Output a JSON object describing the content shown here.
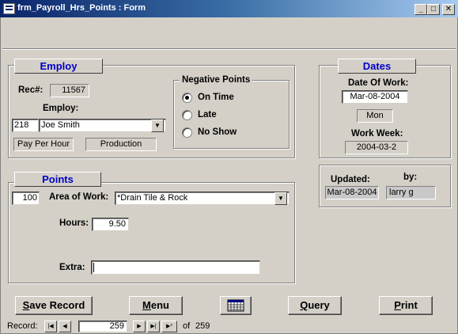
{
  "window": {
    "title": "frm_Payroll_Hrs_Points : Form",
    "min": "_",
    "max": "□",
    "close": "✕"
  },
  "employ": {
    "tab": "Employ",
    "rec_label": "Rec#:",
    "rec_value": "11567",
    "employ_label": "Employ:",
    "employee_id": "218",
    "employee_name": "Joe Smith",
    "pay_type": "Pay Per Hour",
    "department": "Production"
  },
  "negative_points": {
    "title": "Negative Points",
    "options": [
      {
        "label": "On Time",
        "selected": true
      },
      {
        "label": "Late",
        "selected": false
      },
      {
        "label": "No Show",
        "selected": false
      }
    ]
  },
  "dates": {
    "tab": "Dates",
    "date_of_work_label": "Date Of Work:",
    "date_of_work": "Mar-08-2004",
    "weekday": "Mon",
    "work_week_label": "Work Week:",
    "work_week": "2004-03-2"
  },
  "updated": {
    "updated_label": "Updated:",
    "by_label": "by:",
    "updated_value": "Mar-08-2004",
    "by_value": "larry g"
  },
  "points": {
    "tab": "Points",
    "value": "100",
    "area_label": "Area of Work:",
    "area_value": "*Drain Tile & Rock",
    "hours_label": "Hours:",
    "hours_value": "9.50",
    "extra_label": "Extra:",
    "extra_value": ""
  },
  "buttons": {
    "save_first": "S",
    "save_rest": "ave Record",
    "menu_first": "M",
    "menu_rest": "enu",
    "query_first": "Q",
    "query_rest": "uery",
    "print_first": "P",
    "print_rest": "rint",
    "calendar_icon": "calendar-icon"
  },
  "navigation": {
    "label": "Record:",
    "current": "259",
    "of_label": "of",
    "total": "259"
  }
}
